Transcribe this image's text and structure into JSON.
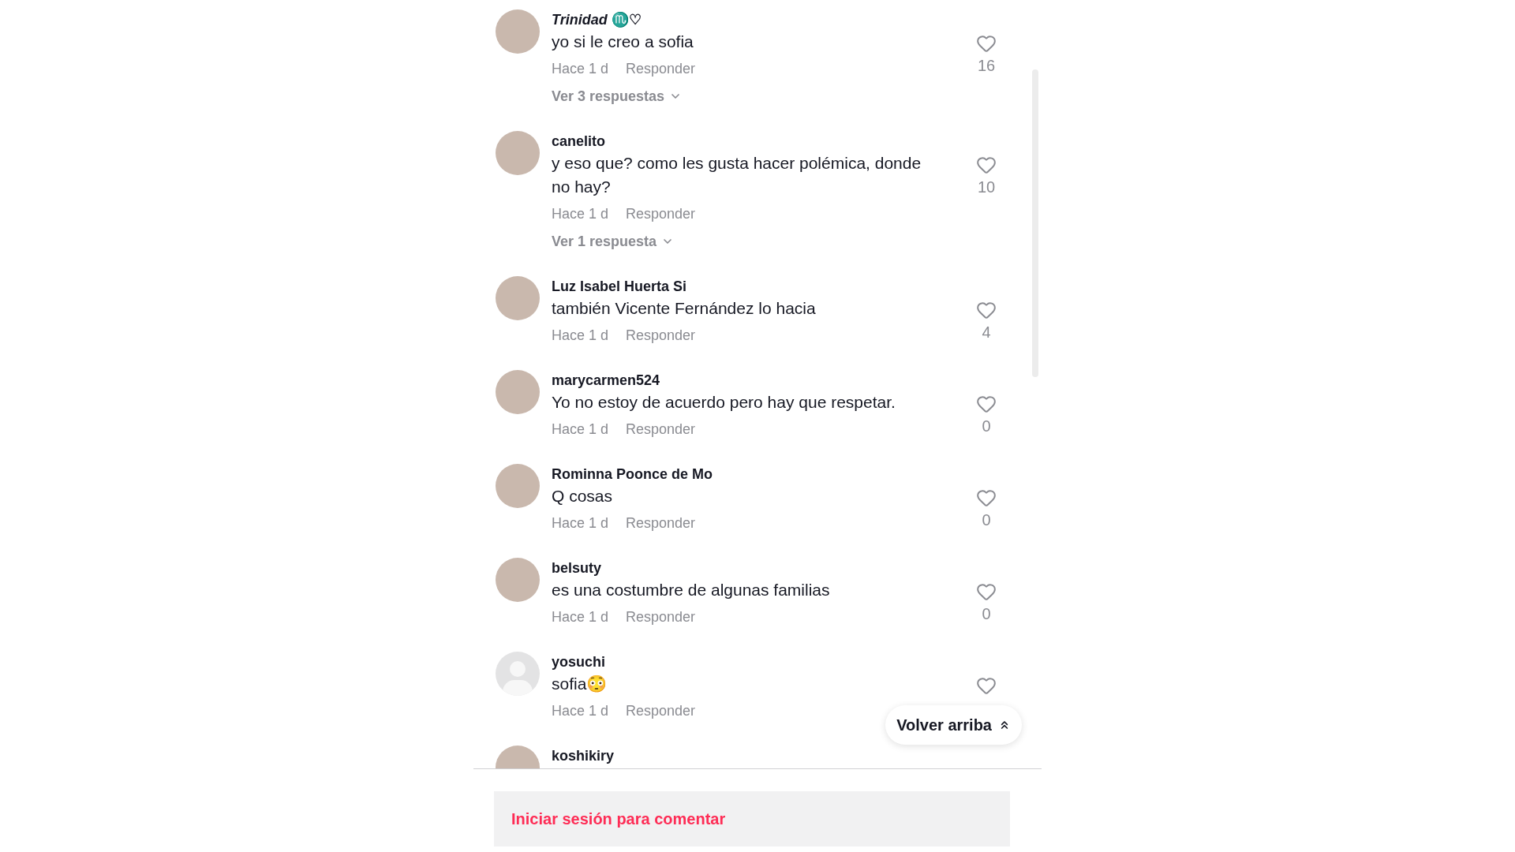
{
  "comments": [
    {
      "avatar": {
        "kind": "photo"
      },
      "name": "*Trinidad* ♏♡",
      "text": "yo si le creo a sofia",
      "time": "Hace 1 d",
      "reply": "Responder",
      "likes": "16",
      "replies": "Ver 3 respuestas"
    },
    {
      "avatar": {
        "kind": "photo"
      },
      "name": "canelito",
      "text": "y eso que? como les gusta hacer polémica, donde no hay?",
      "time": "Hace 1 d",
      "reply": "Responder",
      "likes": "10",
      "replies": "Ver 1 respuesta"
    },
    {
      "avatar": {
        "kind": "photo"
      },
      "name": "Luz Isabel Huerta Si",
      "text": "también Vicente Fernández lo hacia",
      "time": "Hace 1 d",
      "reply": "Responder",
      "likes": "4"
    },
    {
      "avatar": {
        "kind": "photo"
      },
      "name": "marycarmen524",
      "text": "Yo no estoy de acuerdo pero hay que respetar.",
      "time": "Hace 1 d",
      "reply": "Responder",
      "likes": "0"
    },
    {
      "avatar": {
        "kind": "photo"
      },
      "name": "Rominna Poonce de Mo",
      "text": "Q cosas",
      "time": "Hace 1 d",
      "reply": "Responder",
      "likes": "0"
    },
    {
      "avatar": {
        "kind": "photo"
      },
      "name": "belsuty",
      "text": "es una costumbre de algunas familias",
      "time": "Hace 1 d",
      "reply": "Responder",
      "likes": "0"
    },
    {
      "avatar": {
        "kind": "default"
      },
      "name": "yosuchi",
      "text": "sofia😳",
      "time": "Hace 1 d",
      "reply": "Responder"
    },
    {
      "avatar": {
        "kind": "photo"
      },
      "name": "koshikiry"
    }
  ],
  "back_to_top": "Volver arriba",
  "login_prompt": "Iniciar sesión para comentar"
}
